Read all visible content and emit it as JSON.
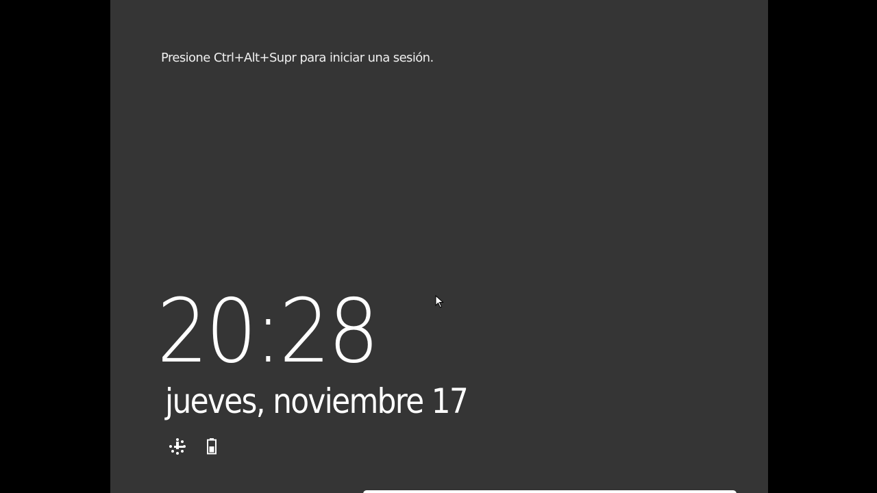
{
  "lock_screen": {
    "hint": "Presione Ctrl+Alt+Supr para iniciar una sesión.",
    "time": "20:28",
    "date": "jueves, noviembre 17",
    "status_icons": [
      "network-icon",
      "battery-icon"
    ]
  },
  "colors": {
    "background": "#000000",
    "panel": "#353535",
    "text": "#ffffff"
  }
}
